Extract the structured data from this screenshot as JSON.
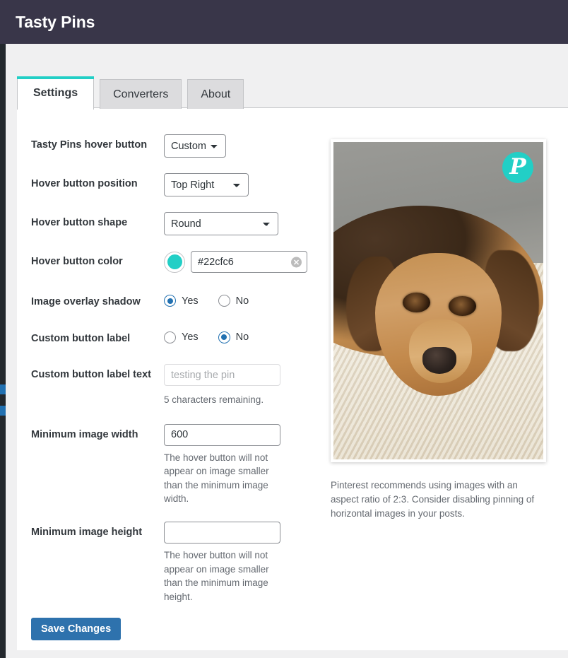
{
  "header": {
    "title": "Tasty Pins"
  },
  "tabs": [
    {
      "label": "Settings",
      "active": true
    },
    {
      "label": "Converters",
      "active": false
    },
    {
      "label": "About",
      "active": false
    }
  ],
  "form": {
    "hover_button": {
      "label": "Tasty Pins hover button",
      "value": "Custom",
      "options": [
        "Custom"
      ]
    },
    "hover_position": {
      "label": "Hover button position",
      "value": "Top Right",
      "options": [
        "Top Right"
      ]
    },
    "hover_shape": {
      "label": "Hover button shape",
      "value": "Round",
      "options": [
        "Round"
      ]
    },
    "hover_color": {
      "label": "Hover button color",
      "value": "#22cfc6",
      "swatch_color": "#22cfc6",
      "clear_icon": "clear-circle-icon"
    },
    "overlay_shadow": {
      "label": "Image overlay shadow",
      "options": [
        "Yes",
        "No"
      ],
      "selected": "Yes"
    },
    "custom_button_label": {
      "label": "Custom button label",
      "options": [
        "Yes",
        "No"
      ],
      "selected": "No"
    },
    "custom_button_label_text": {
      "label": "Custom button label text",
      "value": "",
      "placeholder": "testing the pin",
      "help": "5 characters remaining."
    },
    "min_image_width": {
      "label": "Minimum image width",
      "value": "600",
      "help": "The hover button will not appear on image smaller than the minimum image width."
    },
    "min_image_height": {
      "label": "Minimum image height",
      "value": "",
      "help": "The hover button will not appear on image smaller than the minimum image height."
    },
    "save_label": "Save Changes"
  },
  "preview": {
    "pinterest_icon": "pinterest-icon",
    "pinterest_glyph": "P",
    "badge_color": "#22cfc6",
    "caption": "Pinterest recommends using images with an aspect ratio of 2:3. Consider disabling pinning of horizontal images in your posts."
  },
  "colors": {
    "header_bg": "#393649",
    "tab_accent": "#22cfc6",
    "radio_blue": "#2271b1",
    "save_button_bg": "#2e72ad",
    "sidebar_bg": "#23282d",
    "sidebar_marker": "#2271b1"
  }
}
